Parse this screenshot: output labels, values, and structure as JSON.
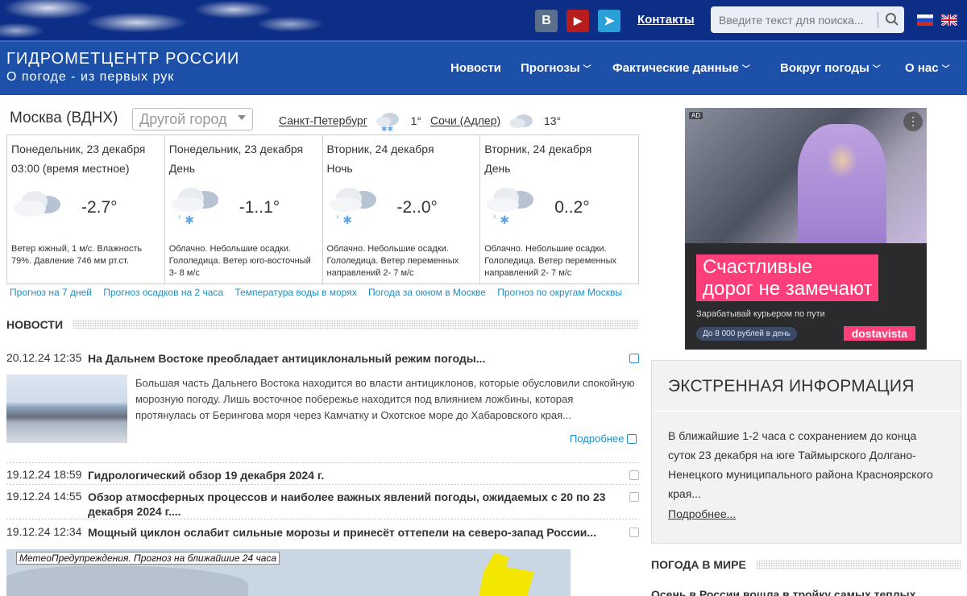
{
  "top": {
    "social": [
      {
        "name": "vk",
        "label": "В"
      },
      {
        "name": "youtube",
        "label": "▶"
      },
      {
        "name": "telegram",
        "label": "➤"
      }
    ],
    "contacts": "Контакты",
    "search_placeholder": "Введите текст для поиска...",
    "flags": [
      "ru",
      "en"
    ]
  },
  "brand": {
    "title": "ГИДРОМЕТЦЕНТР РОССИИ",
    "tagline": "О погоде - из первых рук"
  },
  "nav": [
    {
      "label": "Новости",
      "chevron": false
    },
    {
      "label": "Прогнозы",
      "chevron": true
    },
    {
      "label": "Фактические данные",
      "chevron": true
    },
    {
      "label": "Вокруг погоды",
      "chevron": true
    },
    {
      "label": "О нас",
      "chevron": true
    }
  ],
  "weather": {
    "city": "Москва (ВДНХ)",
    "other_city": "Другой город",
    "mini": [
      {
        "city": "Санкт-Петербург",
        "temp": "1°",
        "icon": "snow-cloud-icon"
      },
      {
        "city": "Сочи (Адлер)",
        "temp": "13°",
        "icon": "cloud-icon"
      }
    ],
    "forecast": [
      {
        "day": "Понедельник, 23 декабря",
        "period": "03:00 (время местное)",
        "icon": "cloud-icon",
        "temp": "-2.7°",
        "desc": "Ветер южный, 1 м/с. Влажность 79%. Давление 746 мм рт.ст."
      },
      {
        "day": "Понедельник, 23 декабря",
        "period": "День",
        "icon": "snow-cloud-icon",
        "temp": "-1..1°",
        "desc": "Облачно. Небольшие осадки. Гололедица. Ветер юго-восточный 3- 8 м/с"
      },
      {
        "day": "Вторник, 24 декабря",
        "period": "Ночь",
        "icon": "snow-cloud-icon",
        "temp": "-2..0°",
        "desc": "Облачно. Небольшие осадки. Гололедица. Ветер переменных направлений 2- 7 м/с"
      },
      {
        "day": "Вторник, 24 декабря",
        "period": "День",
        "icon": "snow-cloud-icon",
        "temp": "0..2°",
        "desc": "Облачно. Небольшие осадки. Гололедица. Ветер переменных направлений 2- 7 м/с"
      }
    ],
    "links": [
      "Прогноз на 7 дней",
      "Прогноз осадков на 2 часа",
      "Температура воды в морях",
      "Погода за окном в Москве",
      "Прогноз по округам Москвы"
    ]
  },
  "news": {
    "title": "НОВОСТИ",
    "featured": {
      "date": "20.12.24 12:35",
      "title": "На Дальнем Востоке преобладает антициклональный режим погоды...",
      "body": "Большая часть Дальнего Востока находится во власти антициклонов, которые обусловили спокойную морозную погоду.  Лишь восточное побережье находится под влиянием ложбины, которая протянулась от Берингова моря через Камчатку и Охотское море до Хабаровского края...",
      "more": "Подробнее"
    },
    "items": [
      {
        "date": "19.12.24 18:59",
        "title": "Гидрологический обзор 19 декабря 2024 г."
      },
      {
        "date": "19.12.24 14:55",
        "title": "Обзор атмосферных процессов и наиболее важных явлений погоды, ожидаемых с 20 по 23 декабря 2024 г...."
      },
      {
        "date": "19.12.24 12:34",
        "title": "Мощный циклон ослабит сильные морозы и принесёт оттепели на северо-запад России..."
      }
    ],
    "map_label": "МетеоПредупреждения. Прогноз на ближайшие 24 часа"
  },
  "ad": {
    "badge": "AD",
    "headline_1": "Счастливые",
    "headline_2": "дорог не замечают",
    "sub": "Зарабатывай курьером по пути",
    "pill": "До 8 000 рублей в день",
    "logo": "dostavista"
  },
  "emergency": {
    "title": "ЭКСТРЕННАЯ ИНФОРМАЦИЯ",
    "body": "В ближайшие 1-2 часа с сохранением до конца суток 23 декабря на юге Таймырского Долгано-Ненецкого муниципального района Красноярского края...",
    "more": "Подробнее..."
  },
  "world": {
    "title": "ПОГОДА В МИРЕ",
    "teaser": "Осень в России вошла в тройку самых теплых"
  }
}
